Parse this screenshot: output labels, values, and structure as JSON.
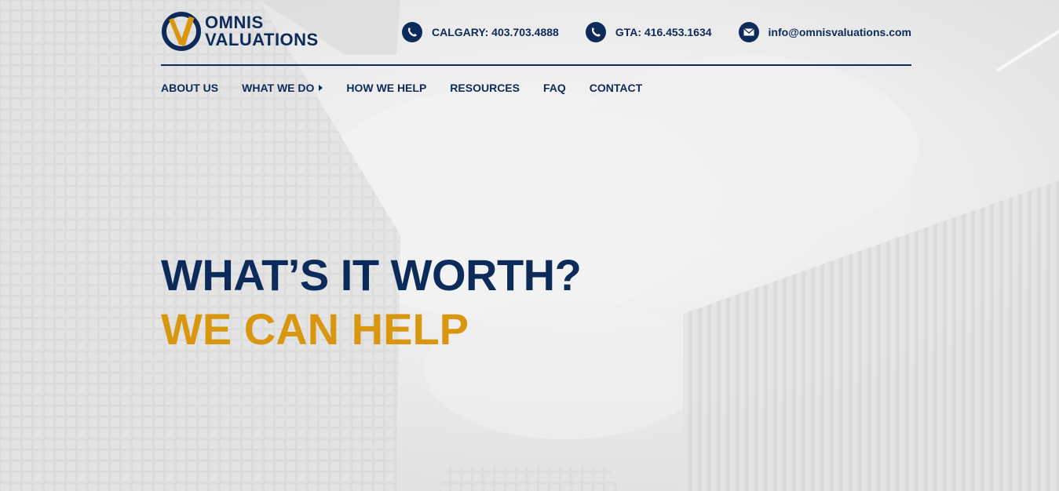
{
  "brand": {
    "line1": "OMNIS",
    "line2": "VALUATIONS",
    "navy": "#0d2b5a",
    "gold": "#d9960f"
  },
  "contacts": [
    {
      "icon": "phone-icon",
      "label": "CALGARY: 403.703.4888"
    },
    {
      "icon": "phone-icon",
      "label": "GTA: 416.453.1634"
    },
    {
      "icon": "mail-icon",
      "label": "info@omnisvaluations.com"
    }
  ],
  "nav": {
    "items": [
      {
        "label": "ABOUT US"
      },
      {
        "label": "WHAT WE DO",
        "has_submenu": true
      },
      {
        "label": "HOW WE HELP"
      },
      {
        "label": "RESOURCES"
      },
      {
        "label": "FAQ"
      },
      {
        "label": "CONTACT"
      }
    ]
  },
  "hero": {
    "title": "WHAT’S IT WORTH?",
    "subtitle": "WE CAN HELP"
  }
}
